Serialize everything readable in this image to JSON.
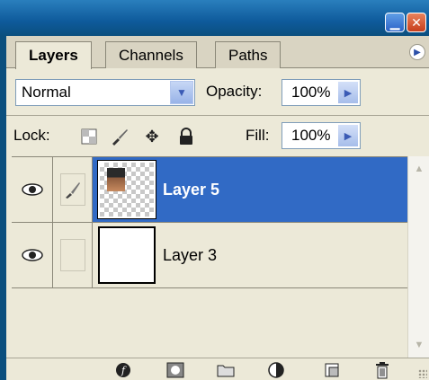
{
  "window": {
    "min_icon": "minimize-icon",
    "close_icon": "close-icon",
    "min_glyph": "▁",
    "close_glyph": "✕"
  },
  "tabs": [
    {
      "label": "Layers",
      "active": true
    },
    {
      "label": "Channels",
      "active": false
    },
    {
      "label": "Paths",
      "active": false
    }
  ],
  "blend": {
    "mode": "Normal",
    "opacity_label": "Opacity:",
    "opacity_value": "100%"
  },
  "lock": {
    "label": "Lock:",
    "icons": [
      "lock-transparent-icon",
      "lock-image-icon",
      "lock-position-icon",
      "lock-all-icon"
    ],
    "fill_label": "Fill:",
    "fill_value": "100%"
  },
  "layers": [
    {
      "name": "Layer 5",
      "selected": true,
      "visible": true,
      "brush_link": true
    },
    {
      "name": "Layer 3",
      "selected": false,
      "visible": true,
      "brush_link": false
    }
  ],
  "bottom_buttons": [
    "link-layers-icon",
    "add-layer-style-icon",
    "add-mask-icon",
    "new-group-icon",
    "adjustment-layer-icon",
    "new-layer-icon",
    "delete-layer-icon"
  ],
  "colors": {
    "selection": "#316ac5",
    "panel_bg": "#ece9d8",
    "titlebar": "#0b4f7e"
  }
}
